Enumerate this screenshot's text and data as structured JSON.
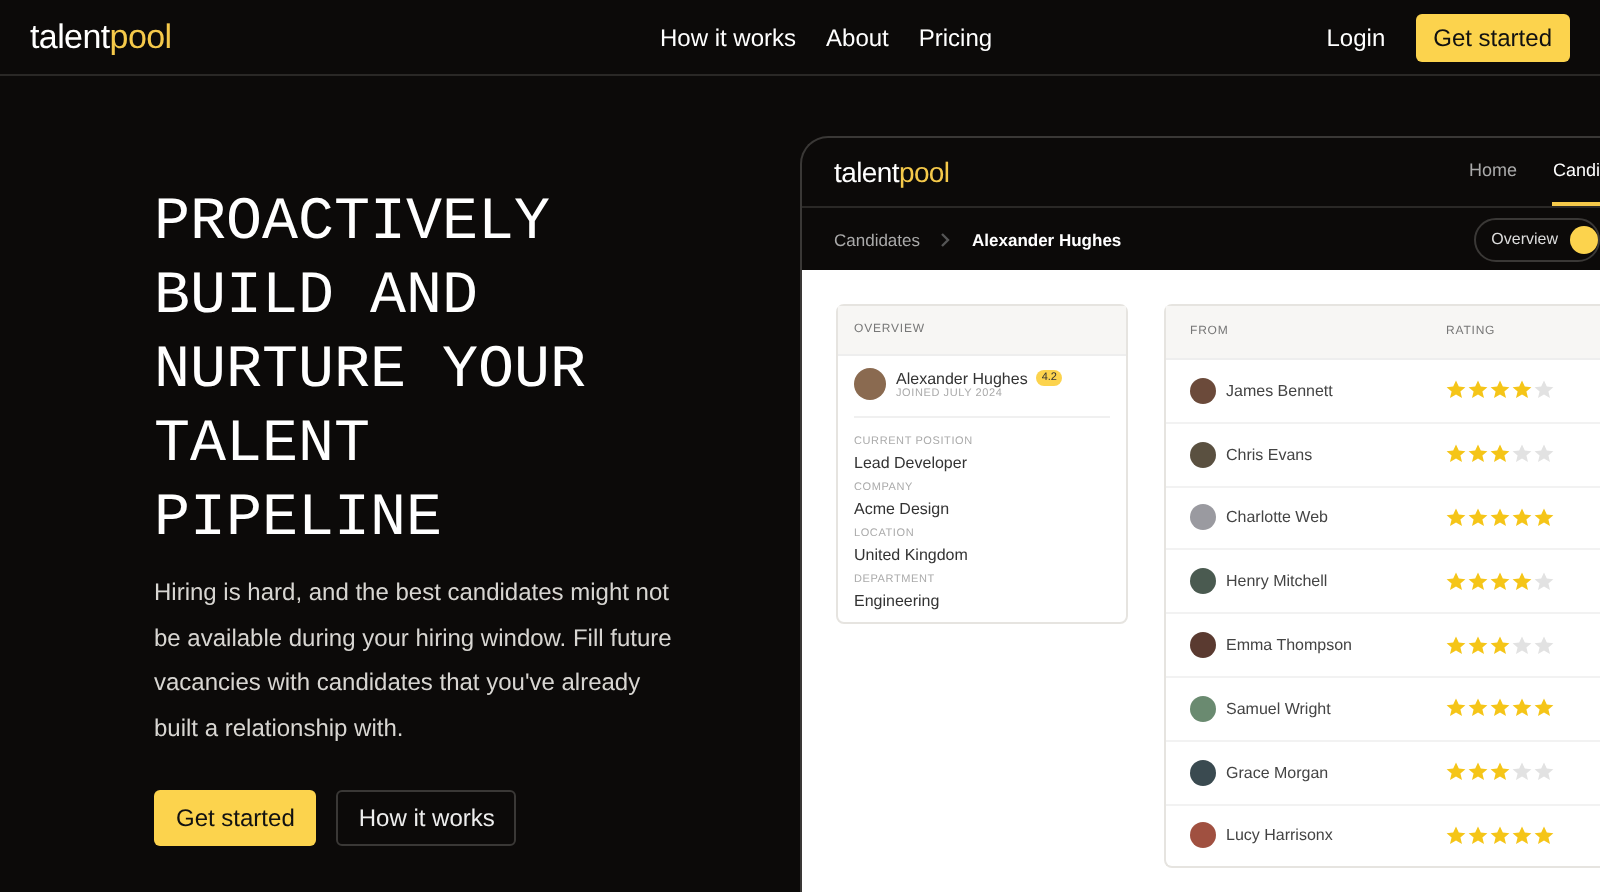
{
  "nav": {
    "logo": {
      "first": "talent",
      "second": "pool"
    },
    "links": [
      "How it works",
      "About",
      "Pricing"
    ],
    "login": "Login",
    "cta": "Get started"
  },
  "hero": {
    "title": "PROACTIVELY BUILD AND NURTURE YOUR TALENT PIPELINE",
    "text": "Hiring is hard, and the best candidates might not be available during your hiring window. Fill future vacancies with candidates that you've already built a relationship with.",
    "primary": "Get started",
    "secondary": "How it works"
  },
  "app": {
    "logo": {
      "first": "talent",
      "second": "pool"
    },
    "tabs": [
      {
        "label": "Home",
        "selected": false
      },
      {
        "label": "Candi",
        "selected": true
      }
    ],
    "breadcrumb": [
      "Candidates",
      "Alexander Hughes"
    ],
    "view_switch": {
      "label": "Overview",
      "on": true
    },
    "overview": {
      "heading": "OVERVIEW",
      "name": "Alexander Hughes",
      "score": "4.2",
      "joined": "JOINED JULY 2024",
      "fields": [
        {
          "label": "CURRENT POSITION",
          "value": "Lead Developer"
        },
        {
          "label": "COMPANY",
          "value": "Acme Design"
        },
        {
          "label": "LOCATION",
          "value": "United Kingdom"
        },
        {
          "label": "DEPARTMENT",
          "value": "Engineering"
        }
      ]
    },
    "ratings": {
      "columns": [
        "FROM",
        "RATING"
      ],
      "rows": [
        {
          "name": "James Bennett",
          "stars": 4
        },
        {
          "name": "Chris Evans",
          "stars": 3
        },
        {
          "name": "Charlotte Web",
          "stars": 5
        },
        {
          "name": "Henry Mitchell",
          "stars": 4
        },
        {
          "name": "Emma Thompson",
          "stars": 3
        },
        {
          "name": "Samuel Wright",
          "stars": 5
        },
        {
          "name": "Grace Morgan",
          "stars": 3
        },
        {
          "name": "Lucy Harrisonx",
          "stars": 5
        }
      ]
    }
  }
}
